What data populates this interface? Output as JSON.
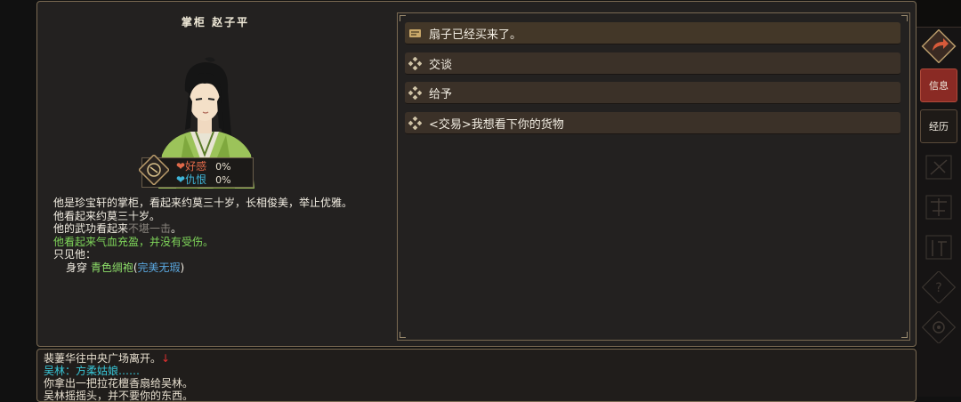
{
  "npc": {
    "title": "掌柜  赵子平",
    "stats": {
      "favor_label": "好感",
      "favor_value": "0%",
      "hatred_label": "仇恨",
      "hatred_value": "0%"
    },
    "description": {
      "line1": "他是珍宝轩的掌柜，看起来约莫三十岁，长相俊美，举止优雅。",
      "line2": "他看起来约莫三十岁。",
      "line3_prefix": "他的武功看起来",
      "line3_gray": "不堪一击",
      "line3_suffix": "。",
      "line4_prefix": "他",
      "line4_green": "看起来气血充盈，并没有受伤。",
      "line5": "只见他：",
      "line6_prefix": "身穿  ",
      "line6_item": "青色绸袍",
      "line6_paren_open": "(",
      "line6_quality": "完美无瑕",
      "line6_paren_close": ")"
    }
  },
  "dialog": {
    "options": [
      {
        "label": "扇子已经买来了。",
        "icon": "quest-scroll-icon"
      },
      {
        "label": "交谈",
        "icon": "diamond-bullet-icon"
      },
      {
        "label": "给予",
        "icon": "diamond-bullet-icon"
      },
      {
        "label": "<交易>我想看下你的货物",
        "icon": "diamond-bullet-icon"
      }
    ]
  },
  "sidebar": {
    "info_label": "信息",
    "history_label": "经历",
    "ghost_icons": [
      "craft-icon",
      "martial-icon",
      "sect-icon",
      "help-icon",
      "settings-icon"
    ]
  },
  "log": {
    "line1": "裴萋华往中央广场离开。",
    "line1_arrow": "↓",
    "line2": "吴林：方柔姑娘……",
    "line3": "你拿出一把拉花檀香扇给吴林。",
    "line4": "吴林摇摇头，并不要你的东西。"
  },
  "colors": {
    "panel_bg": "#232120",
    "option_bg": "#3b3128",
    "border": "#7a6a52",
    "favor": "#e06a4a",
    "hatred": "#3fb5d8",
    "green_text": "#7fd65a",
    "quality_blue": "#5aa8e0",
    "log_cyan": "#38c7d8",
    "accent_red": "#8a2a24"
  }
}
